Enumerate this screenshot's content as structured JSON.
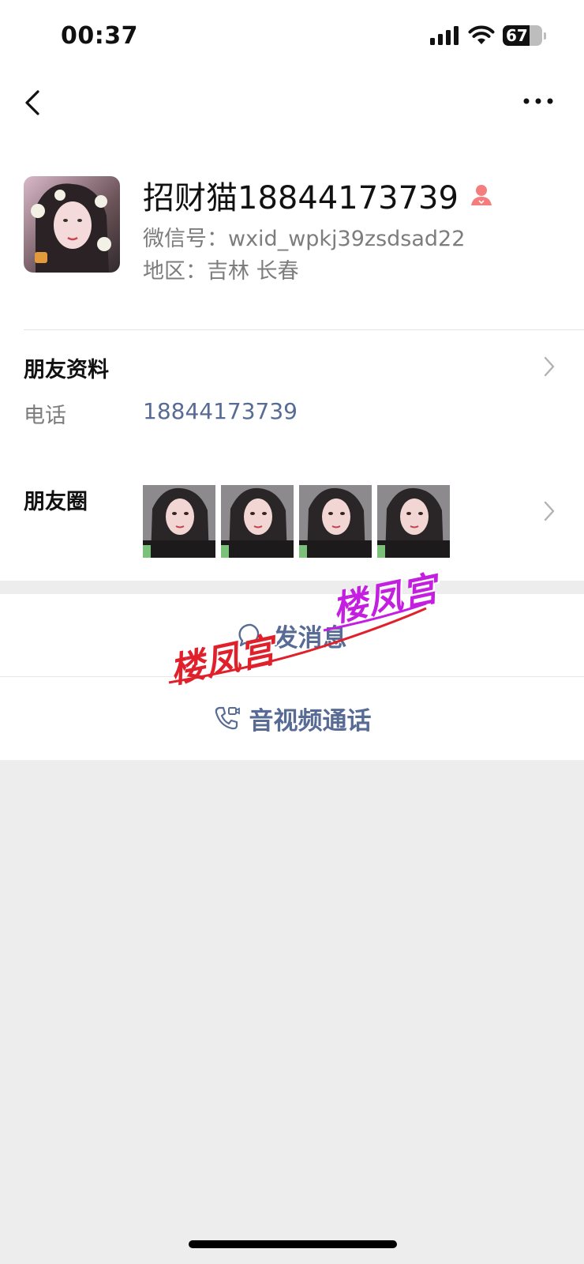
{
  "status_bar": {
    "time": "00:37",
    "battery_percent": "67",
    "battery_level": 0.67
  },
  "profile": {
    "name": "招财猫18844173739",
    "wechat_id": "微信号：wxid_wpkj39zsdsad22",
    "region": "地区：吉林 长春",
    "gender_icon": "female-icon",
    "gender_color": "#f37e7d"
  },
  "friend_info": {
    "title": "朋友资料",
    "phone_label": "电话",
    "phone_value": "18844173739"
  },
  "moments": {
    "title": "朋友圈",
    "thumbnail_count": 4
  },
  "actions": {
    "send_message": "发消息",
    "av_call": "音视频通话"
  },
  "watermark": {
    "text": "楼凤宫"
  },
  "colors": {
    "link": "#576b95",
    "background": "#ededed"
  }
}
